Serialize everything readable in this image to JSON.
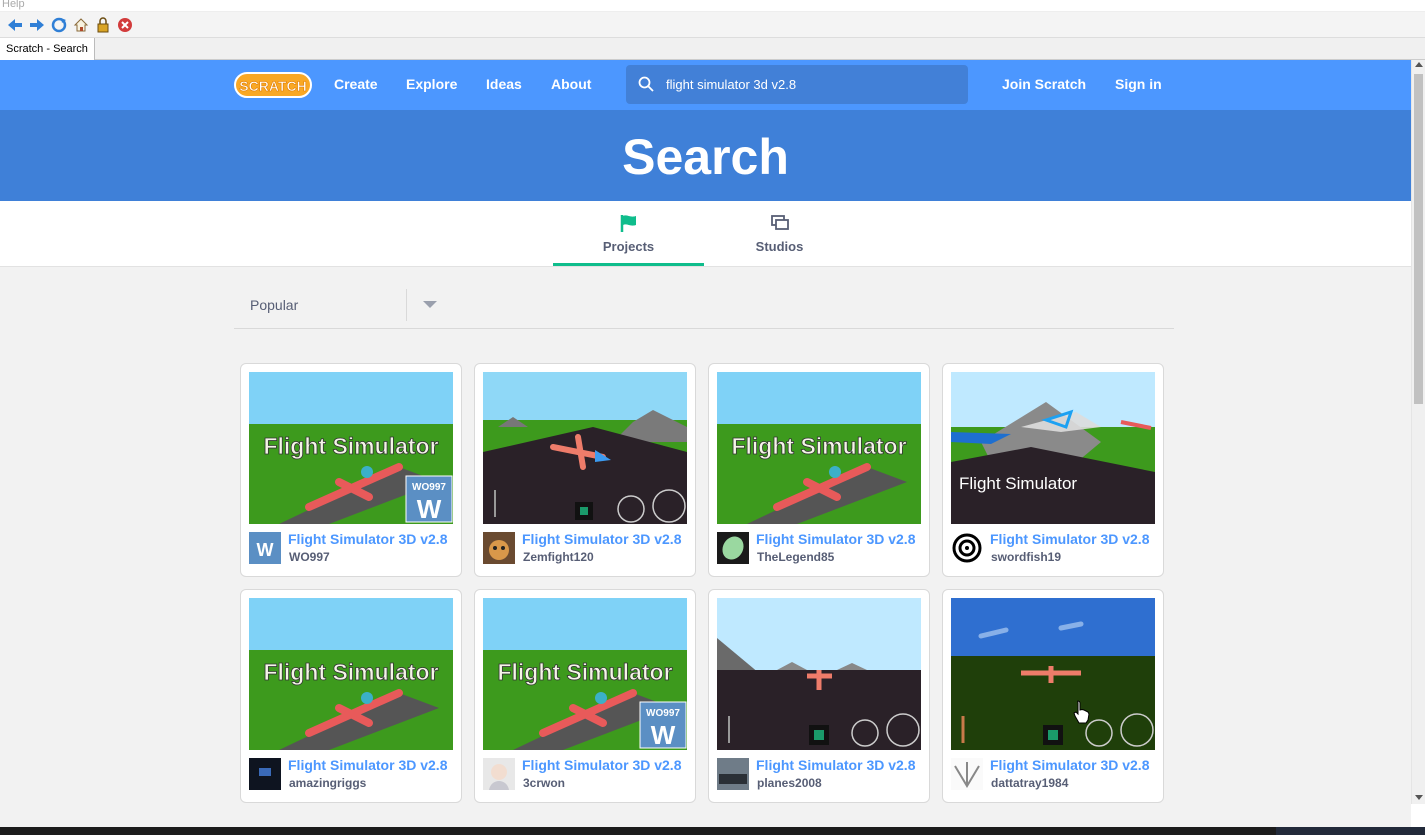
{
  "browser": {
    "menu_text": "Help",
    "tab_title": "Scratch - Search"
  },
  "nav": {
    "logo_text": "SCRATCH",
    "links": [
      "Create",
      "Explore",
      "Ideas",
      "About"
    ],
    "search_value": "flight simulator 3d v2.8",
    "join": "Join Scratch",
    "signin": "Sign in"
  },
  "banner": {
    "title": "Search"
  },
  "tabs": [
    {
      "label": "Projects",
      "icon": "flag-icon",
      "active": true
    },
    {
      "label": "Studios",
      "icon": "studios-icon",
      "active": false
    }
  ],
  "filter": {
    "selected": "Popular"
  },
  "projects": [
    {
      "title": "Flight Simulator 3D v2.8",
      "owner": "WO997",
      "thumb": "title",
      "badge": "WO997",
      "thumb_text": "Flight Simulator",
      "avatar": "wo"
    },
    {
      "title": "Flight Simulator 3D v2.8",
      "owner": "Zemfight120",
      "thumb": "runway",
      "avatar": "cat"
    },
    {
      "title": "Flight Simulator 3D v2.8",
      "owner": "TheLegend85",
      "thumb": "title",
      "thumb_text": "Flight Simulator",
      "avatar": "leaf"
    },
    {
      "title": "Flight Simulator 3D v2.8",
      "owner": "swordfish19",
      "thumb": "mountain",
      "thumb_text": "Flight Simulator",
      "avatar": "swirl"
    },
    {
      "title": "Flight Simulator 3D v2.8",
      "owner": "amazingriggs",
      "thumb": "title",
      "thumb_text": "Flight Simulator",
      "avatar": "dark"
    },
    {
      "title": "Flight Simulator 3D v2.8",
      "owner": "3crwon",
      "thumb": "title",
      "badge": "WO997",
      "thumb_text": "Flight Simulator",
      "avatar": "anime"
    },
    {
      "title": "Flight Simulator 3D v2.8",
      "owner": "planes2008",
      "thumb": "cockpit",
      "avatar": "photo"
    },
    {
      "title": "Flight Simulator 3D v2.8",
      "owner": "dattatray1984",
      "thumb": "dark",
      "avatar": "sketch"
    }
  ]
}
